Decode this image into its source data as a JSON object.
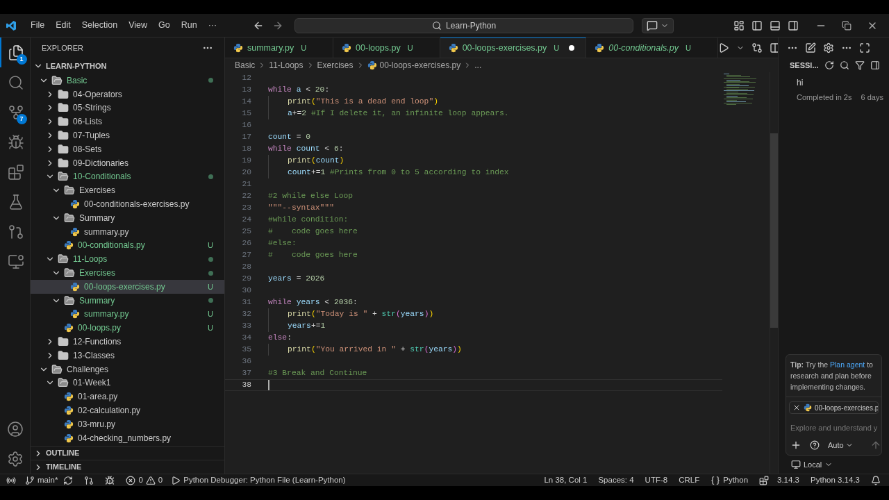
{
  "title_bar": {
    "menus": [
      "File",
      "Edit",
      "Selection",
      "View",
      "Go",
      "Run",
      "···"
    ],
    "search": "Learn-Python"
  },
  "activity_bar": [
    {
      "kind": "explorer",
      "selected": true,
      "badge": "1"
    },
    {
      "kind": "search",
      "selected": false
    },
    {
      "kind": "source-control",
      "selected": false,
      "badge": "7"
    },
    {
      "kind": "run",
      "selected": false
    },
    {
      "kind": "extensions",
      "selected": false
    },
    {
      "kind": "testing",
      "selected": false
    },
    {
      "kind": "pull-requests",
      "selected": false
    },
    {
      "kind": "remote",
      "selected": false
    }
  ],
  "explorer": {
    "title": "EXPLORER",
    "root": {
      "label": "LEARN-PYTHON",
      "expanded": true,
      "children": [
        {
          "kind": "folder",
          "label": "Basic",
          "expanded": true,
          "modified": true,
          "selected": false,
          "children": [
            {
              "kind": "folder",
              "label": "04-Operators",
              "expanded": false,
              "modified": false,
              "selected": false
            },
            {
              "kind": "folder",
              "label": "05-Strings",
              "expanded": false,
              "modified": false,
              "selected": false
            },
            {
              "kind": "folder",
              "label": "06-Lists",
              "expanded": false,
              "modified": false,
              "selected": false
            },
            {
              "kind": "folder",
              "label": "07-Tuples",
              "expanded": false,
              "modified": false,
              "selected": false
            },
            {
              "kind": "folder",
              "label": "08-Sets",
              "expanded": false,
              "modified": false,
              "selected": false
            },
            {
              "kind": "folder",
              "label": "09-Dictionaries",
              "expanded": false,
              "modified": false,
              "selected": false
            },
            {
              "kind": "folder",
              "label": "10-Conditionals",
              "expanded": true,
              "modified": true,
              "selected": false,
              "children": [
                {
                  "kind": "folder",
                  "label": "Exercises",
                  "expanded": true,
                  "modified": false,
                  "selected": false,
                  "children": [
                    {
                      "kind": "file",
                      "label": "00-conditionals-exercises.py",
                      "modified": false,
                      "selected": false
                    }
                  ]
                },
                {
                  "kind": "folder",
                  "label": "Summary",
                  "expanded": true,
                  "modified": false,
                  "selected": false,
                  "children": [
                    {
                      "kind": "file",
                      "label": "summary.py",
                      "modified": false,
                      "selected": false
                    }
                  ]
                },
                {
                  "kind": "file",
                  "label": "00-conditionals.py",
                  "modified": true,
                  "selected": false,
                  "badge": "U"
                }
              ]
            },
            {
              "kind": "folder",
              "label": "11-Loops",
              "expanded": true,
              "modified": true,
              "selected": false,
              "children": [
                {
                  "kind": "folder",
                  "label": "Exercises",
                  "expanded": true,
                  "modified": true,
                  "selected": false,
                  "children": [
                    {
                      "kind": "file",
                      "label": "00-loops-exercises.py",
                      "modified": true,
                      "selected": true,
                      "badge": "U"
                    }
                  ]
                },
                {
                  "kind": "folder",
                  "label": "Summary",
                  "expanded": true,
                  "modified": true,
                  "selected": false,
                  "children": [
                    {
                      "kind": "file",
                      "label": "summary.py",
                      "modified": true,
                      "selected": false,
                      "badge": "U"
                    }
                  ]
                },
                {
                  "kind": "file",
                  "label": "00-loops.py",
                  "modified": true,
                  "selected": false,
                  "badge": "U"
                }
              ]
            },
            {
              "kind": "folder",
              "label": "12-Functions",
              "expanded": false,
              "modified": false,
              "selected": false
            },
            {
              "kind": "folder",
              "label": "13-Classes",
              "expanded": false,
              "modified": false,
              "selected": false
            }
          ]
        },
        {
          "kind": "folder",
          "label": "Challenges",
          "expanded": true,
          "modified": false,
          "selected": false,
          "children": [
            {
              "kind": "folder",
              "label": "01-Week1",
              "expanded": true,
              "modified": false,
              "selected": false,
              "children": [
                {
                  "kind": "file",
                  "label": "01-area.py",
                  "modified": false,
                  "selected": false
                },
                {
                  "kind": "file",
                  "label": "02-calculation.py",
                  "modified": false,
                  "selected": false
                },
                {
                  "kind": "file",
                  "label": "03-mru.py",
                  "modified": false,
                  "selected": false
                },
                {
                  "kind": "file",
                  "label": "04-checking_numbers.py",
                  "modified": false,
                  "selected": false
                }
              ]
            }
          ]
        }
      ]
    },
    "sections": [
      {
        "label": "OUTLINE",
        "expanded": false
      },
      {
        "label": "TIMELINE",
        "expanded": false
      }
    ]
  },
  "tabs": [
    {
      "label": "summary.py",
      "badge": "U",
      "selected": false,
      "preview": false,
      "dirty": false
    },
    {
      "label": "00-loops.py",
      "badge": "U",
      "selected": false,
      "preview": false,
      "dirty": false
    },
    {
      "label": "00-loops-exercises.py",
      "badge": "U",
      "selected": true,
      "preview": false,
      "dirty": true
    },
    {
      "label": "00-conditionals.py",
      "badge": "U",
      "selected": false,
      "preview": true,
      "dirty": false
    }
  ],
  "breadcrumbs": [
    "Basic",
    "11-Loops",
    "Exercises",
    "00-loops-exercises.py",
    "..."
  ],
  "code": [
    {
      "number": "12"
    },
    {
      "number": "13",
      "tokens": [
        {
          "kind": "kw",
          "text": "while "
        },
        {
          "kind": "var",
          "text": "a"
        },
        {
          "kind": "op",
          "text": " < "
        },
        {
          "kind": "num",
          "text": "20"
        },
        {
          "kind": "op",
          "text": ":"
        }
      ]
    },
    {
      "number": "14",
      "indented": true,
      "tokens": [
        {
          "kind": "fn",
          "text": "print"
        },
        {
          "kind": "p1",
          "text": "("
        },
        {
          "kind": "str",
          "text": "\"This is a dead end loop\""
        },
        {
          "kind": "p1",
          "text": ")"
        }
      ]
    },
    {
      "number": "15",
      "indented": true,
      "tokens": [
        {
          "kind": "var",
          "text": "a"
        },
        {
          "kind": "op",
          "text": "+="
        },
        {
          "kind": "num",
          "text": "2"
        },
        {
          "kind": "comment",
          "text": " #If I delete it, an infinite loop appears."
        }
      ]
    },
    {
      "number": "16"
    },
    {
      "number": "17",
      "tokens": [
        {
          "kind": "var",
          "text": "count"
        },
        {
          "kind": "op",
          "text": " = "
        },
        {
          "kind": "num",
          "text": "0"
        }
      ]
    },
    {
      "number": "18",
      "tokens": [
        {
          "kind": "kw",
          "text": "while "
        },
        {
          "kind": "var",
          "text": "count"
        },
        {
          "kind": "op",
          "text": " < "
        },
        {
          "kind": "num",
          "text": "6"
        },
        {
          "kind": "op",
          "text": ":"
        }
      ]
    },
    {
      "number": "19",
      "indented": true,
      "tokens": [
        {
          "kind": "fn",
          "text": "print"
        },
        {
          "kind": "p1",
          "text": "("
        },
        {
          "kind": "var",
          "text": "count"
        },
        {
          "kind": "p1",
          "text": ")"
        }
      ]
    },
    {
      "number": "20",
      "indented": true,
      "tokens": [
        {
          "kind": "var",
          "text": "count"
        },
        {
          "kind": "op",
          "text": "+="
        },
        {
          "kind": "num",
          "text": "1"
        },
        {
          "kind": "comment",
          "text": " #Prints from 0 to 5 according to index"
        }
      ]
    },
    {
      "number": "21"
    },
    {
      "number": "22",
      "tokens": [
        {
          "kind": "comment",
          "text": "#2 while else Loop"
        }
      ]
    },
    {
      "number": "23",
      "tokens": [
        {
          "kind": "str",
          "text": "\"\"\"--syntax\"\"\""
        }
      ]
    },
    {
      "number": "24",
      "tokens": [
        {
          "kind": "comment",
          "text": "#while condition:"
        }
      ]
    },
    {
      "number": "25",
      "tokens": [
        {
          "kind": "comment",
          "text": "#    code goes here"
        }
      ]
    },
    {
      "number": "26",
      "tokens": [
        {
          "kind": "comment",
          "text": "#else:"
        }
      ]
    },
    {
      "number": "27",
      "tokens": [
        {
          "kind": "comment",
          "text": "#    code goes here"
        }
      ]
    },
    {
      "number": "28"
    },
    {
      "number": "29",
      "tokens": [
        {
          "kind": "var",
          "text": "years"
        },
        {
          "kind": "op",
          "text": " = "
        },
        {
          "kind": "num",
          "text": "2026"
        }
      ]
    },
    {
      "number": "30"
    },
    {
      "number": "31",
      "tokens": [
        {
          "kind": "kw",
          "text": "while "
        },
        {
          "kind": "var",
          "text": "years"
        },
        {
          "kind": "op",
          "text": " < "
        },
        {
          "kind": "num",
          "text": "2036"
        },
        {
          "kind": "op",
          "text": ":"
        }
      ]
    },
    {
      "number": "32",
      "indented": true,
      "tokens": [
        {
          "kind": "fn",
          "text": "print"
        },
        {
          "kind": "p1",
          "text": "("
        },
        {
          "kind": "str",
          "text": "\"Today is \""
        },
        {
          "kind": "op",
          "text": " + "
        },
        {
          "kind": "builtin",
          "text": "str"
        },
        {
          "kind": "p2",
          "text": "("
        },
        {
          "kind": "var",
          "text": "years"
        },
        {
          "kind": "p2",
          "text": ")"
        },
        {
          "kind": "p1",
          "text": ")"
        }
      ]
    },
    {
      "number": "33",
      "indented": true,
      "tokens": [
        {
          "kind": "var",
          "text": "years"
        },
        {
          "kind": "op",
          "text": "+="
        },
        {
          "kind": "num",
          "text": "1"
        }
      ]
    },
    {
      "number": "34",
      "tokens": [
        {
          "kind": "kw",
          "text": "else"
        },
        {
          "kind": "op",
          "text": ":"
        }
      ]
    },
    {
      "number": "35",
      "indented": true,
      "tokens": [
        {
          "kind": "fn",
          "text": "print"
        },
        {
          "kind": "p1",
          "text": "("
        },
        {
          "kind": "str",
          "text": "\"You arrived in \""
        },
        {
          "kind": "op",
          "text": " + "
        },
        {
          "kind": "builtin",
          "text": "str"
        },
        {
          "kind": "p2",
          "text": "("
        },
        {
          "kind": "var",
          "text": "years"
        },
        {
          "kind": "p2",
          "text": ")"
        },
        {
          "kind": "p1",
          "text": ")"
        }
      ]
    },
    {
      "number": "36"
    },
    {
      "number": "37",
      "tokens": [
        {
          "kind": "comment",
          "text": "#3 Break and Continue"
        }
      ]
    },
    {
      "number": "38",
      "cursor": true
    }
  ],
  "chat": {
    "title": "SESSI...",
    "sessions": [
      {
        "title": "hi",
        "status": "Completed in 2s",
        "age": "6 days"
      }
    ],
    "tip": {
      "label": "Tip:",
      "before": "Try the",
      "link": "Plan agent",
      "after": "to research and plan before implementing changes."
    },
    "attachment": "00-loops-exercises.p",
    "placeholder": "Explore and understand y",
    "mode": "Auto",
    "location": "Local"
  },
  "status_bar": {
    "branch": "main*",
    "errors": "0",
    "warnings": "0",
    "debug": "Python Debugger: Python File (Learn-Python)",
    "position": "Ln 38, Col 1",
    "indent": "Spaces: 4",
    "encoding": "UTF-8",
    "eol": "CRLF",
    "language": "Python",
    "version": "3.14.3",
    "interpreter": "Python 3.14.3"
  }
}
